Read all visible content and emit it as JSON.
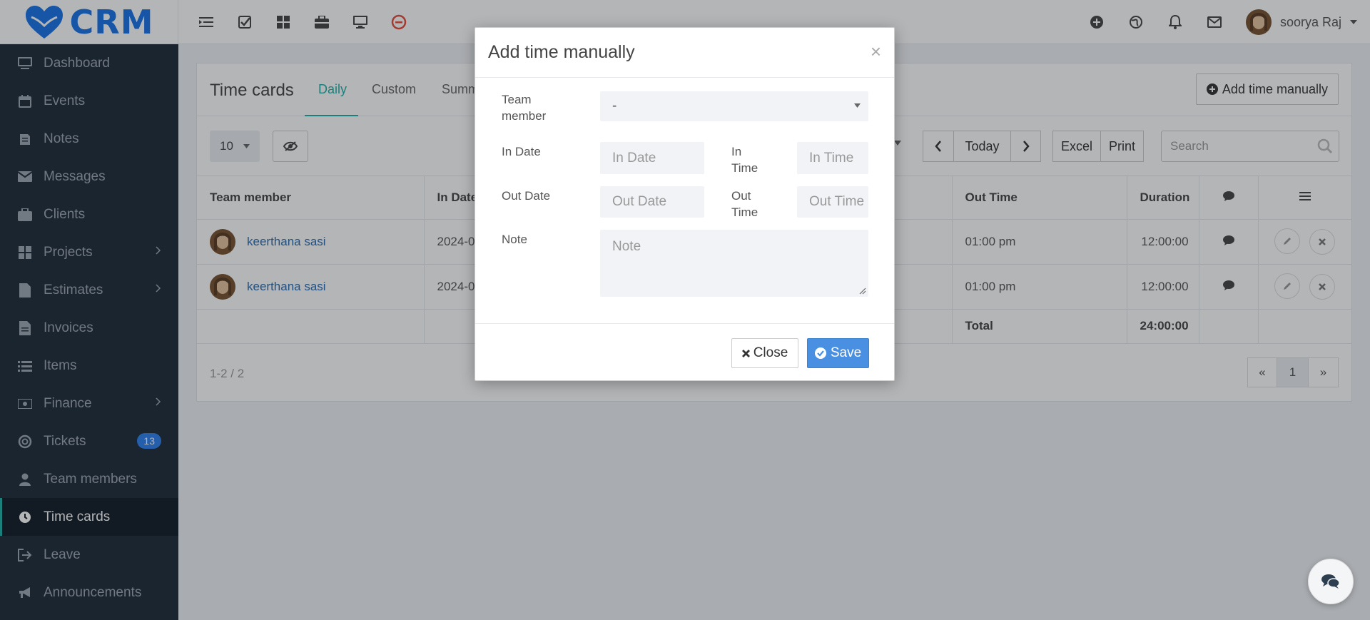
{
  "brand": {
    "name": "CRM",
    "color": "#1a73e8"
  },
  "topbar": {
    "left_icons": [
      "menu-icon",
      "checklist-icon",
      "grid-icon",
      "briefcase-icon",
      "desktop-icon",
      "clock-stop-icon"
    ],
    "right_icons": [
      "plus-icon",
      "globe-icon",
      "bell-icon",
      "mail-icon"
    ],
    "user": {
      "name": "soorya Raj"
    }
  },
  "sidebar": {
    "items": [
      {
        "label": "Dashboard",
        "icon": "desktop-icon"
      },
      {
        "label": "Events",
        "icon": "calendar-icon"
      },
      {
        "label": "Notes",
        "icon": "book-icon"
      },
      {
        "label": "Messages",
        "icon": "envelope-icon"
      },
      {
        "label": "Clients",
        "icon": "briefcase-icon"
      },
      {
        "label": "Projects",
        "icon": "grid-icon",
        "has_children": true
      },
      {
        "label": "Estimates",
        "icon": "file-icon",
        "has_children": true
      },
      {
        "label": "Invoices",
        "icon": "file-text-icon"
      },
      {
        "label": "Items",
        "icon": "list-icon"
      },
      {
        "label": "Finance",
        "icon": "money-icon",
        "has_children": true
      },
      {
        "label": "Tickets",
        "icon": "lifebuoy-icon",
        "badge": "13"
      },
      {
        "label": "Team members",
        "icon": "user-icon"
      },
      {
        "label": "Time cards",
        "icon": "clock-icon",
        "active": true
      },
      {
        "label": "Leave",
        "icon": "sign-out-icon"
      },
      {
        "label": "Announcements",
        "icon": "bullhorn-icon"
      }
    ]
  },
  "page": {
    "title": "Time cards",
    "tabs": [
      "Daily",
      "Custom",
      "Summ"
    ],
    "add_button": "Add time manually",
    "page_size": "10",
    "nav_today": "Today",
    "export_excel": "Excel",
    "export_print": "Print",
    "search_placeholder": "Search",
    "table": {
      "headers": [
        "Team member",
        "In Date",
        "Out Time",
        "Duration"
      ],
      "rows": [
        {
          "member": "keerthana sasi",
          "in_date": "2024-0",
          "out_time": "01:00 pm",
          "duration": "12:00:00"
        },
        {
          "member": "keerthana sasi",
          "in_date": "2024-0",
          "out_time": "01:00 pm",
          "duration": "12:00:00"
        }
      ],
      "total_label": "Total",
      "total_value": "24:00:00"
    },
    "footer_count": "1-2 / 2",
    "pager": {
      "prev": "«",
      "current": "1",
      "next": "»"
    }
  },
  "modal": {
    "title": "Add time manually",
    "close_x": "×",
    "team_member_label": "Team member",
    "team_member_value": "-",
    "in_date_label": "In Date",
    "in_date_placeholder": "In Date",
    "in_time_label": "In Time",
    "in_time_placeholder": "In Time",
    "out_date_label": "Out Date",
    "out_date_placeholder": "Out Date",
    "out_time_label": "Out Time",
    "out_time_placeholder": "Out Time",
    "note_label": "Note",
    "note_placeholder": "Note",
    "close_button": "Close",
    "save_button": "Save",
    "save_color": "#4a90e2"
  },
  "colors": {
    "sidebar_bg": "#1f2b38",
    "accent": "#1fb0a8",
    "link": "#2b6cb0"
  }
}
